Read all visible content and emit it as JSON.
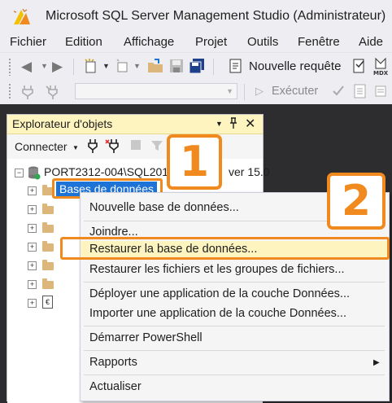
{
  "window": {
    "title": "Microsoft SQL Server Management Studio (Administrateur)"
  },
  "menu": [
    "Fichier",
    "Edition",
    "Affichage",
    "Projet",
    "Outils",
    "Fenêtre",
    "Aide"
  ],
  "toolbar": {
    "new_query_label": "Nouvelle requête",
    "execute_label": "Exécuter"
  },
  "object_explorer": {
    "title": "Explorateur d'objets",
    "connect_label": "Connecter",
    "server_node": "PORT2312-004\\SQL201",
    "server_suffix": "ver 15.0",
    "databases_node": "Bases de données"
  },
  "context_menu": {
    "items": [
      "Nouvelle base de données...",
      "Joindre...",
      "Restaurer la base de données...",
      "Restaurer les fichiers et les groupes de fichiers...",
      "Déployer une application de la couche Données...",
      "Importer une application de la couche Données...",
      "Démarrer PowerShell",
      "Rapports",
      "Actualiser"
    ]
  },
  "callouts": {
    "step1": "1",
    "step2": "2"
  },
  "colors": {
    "accent_orange": "#f08a1e",
    "selection_blue": "#1e73d6",
    "panel_header": "#fdf4bf"
  }
}
